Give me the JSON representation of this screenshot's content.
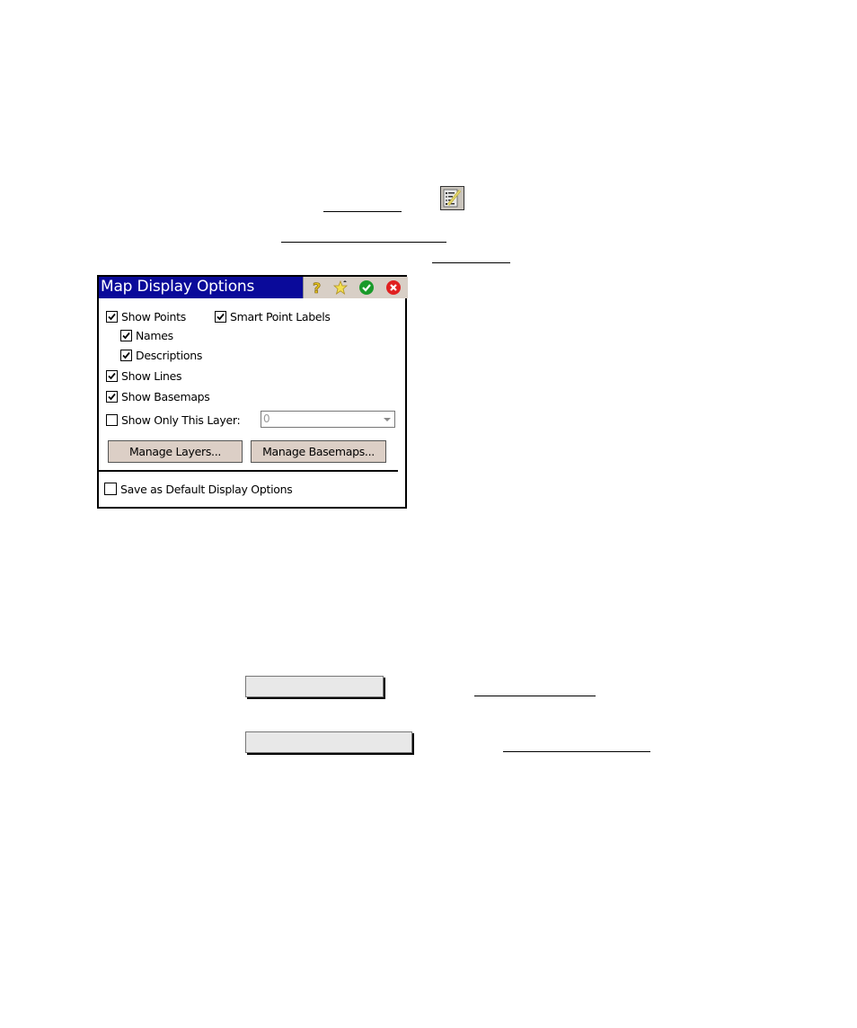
{
  "document": {
    "toolbar_icon": "map-display-options-icon",
    "redacted_links": 4,
    "redacted_placeholders": 2
  },
  "dialog": {
    "title": "Map Display Options",
    "title_icons": [
      "help-icon",
      "favorite-star-icon",
      "ok-check-icon",
      "close-icon"
    ],
    "options": {
      "show_points": {
        "label": "Show Points",
        "checked": true
      },
      "smart_point_labels": {
        "label": "Smart Point Labels",
        "checked": true
      },
      "names": {
        "label": "Names",
        "checked": true
      },
      "descriptions": {
        "label": "Descriptions",
        "checked": true
      },
      "show_lines": {
        "label": "Show Lines",
        "checked": true
      },
      "show_basemaps": {
        "label": "Show Basemaps",
        "checked": true
      },
      "show_only_this_layer": {
        "label": "Show Only This Layer:",
        "checked": false
      },
      "save_default": {
        "label": "Save as Default Display Options",
        "checked": false
      }
    },
    "layer_select": {
      "value": "0"
    },
    "buttons": {
      "manage_layers": "Manage Layers...",
      "manage_basemaps": "Manage Basemaps..."
    }
  }
}
